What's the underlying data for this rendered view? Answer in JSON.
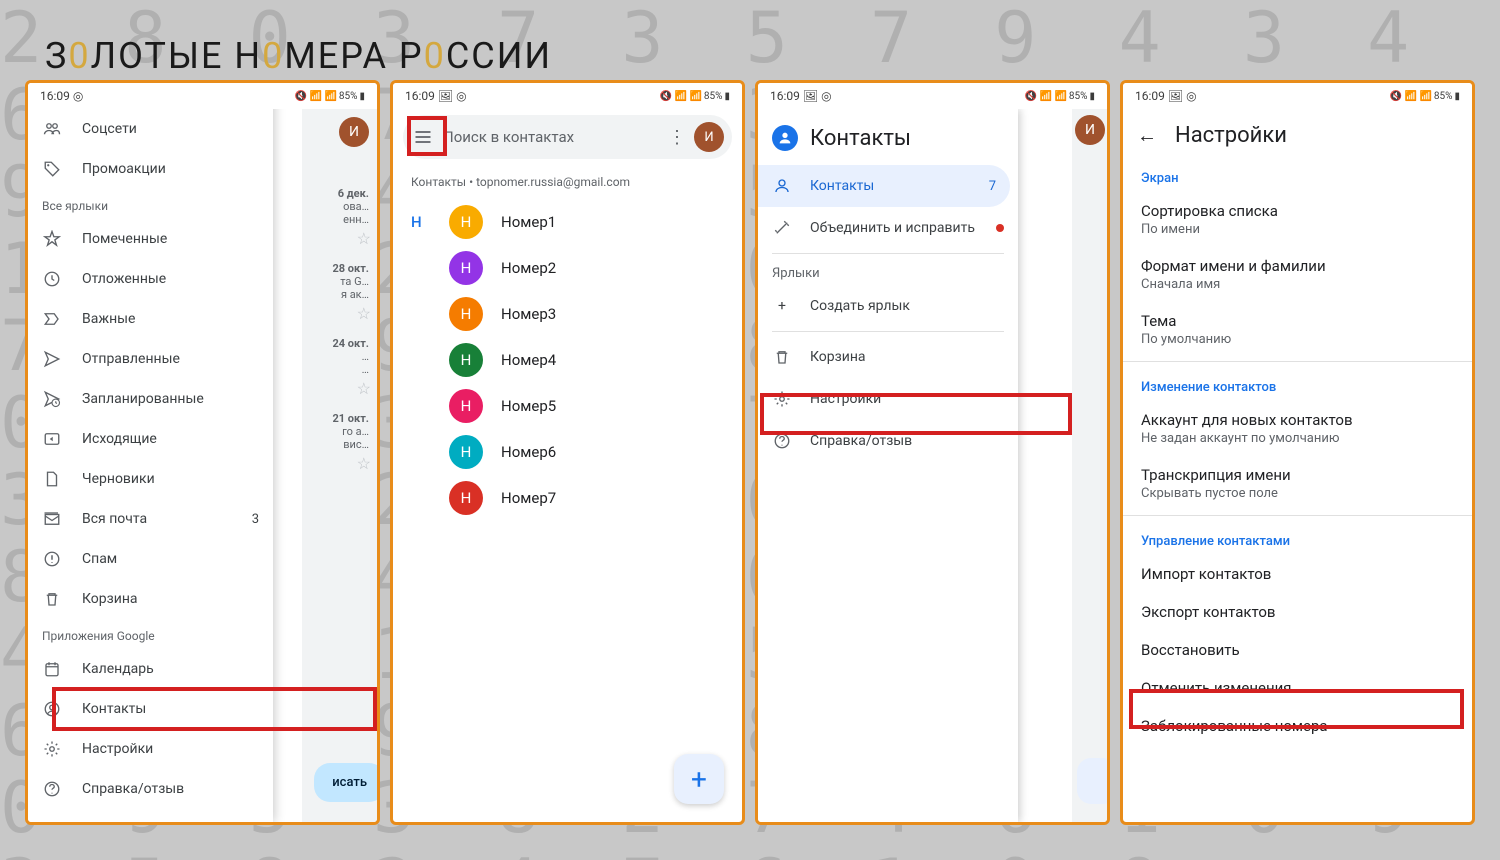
{
  "background_numbers": "2 8 0 3 7 3 5 7 9 4 3 4 6 1 8 7 2 5 3 0 4 2 7 0 9 3 6 4 0 1 5 8 3 9 4 6 1 8 7 2 9 5 0 3 8 4 6 2 7 1 0 9 3 5 8 2 4 7 6 1 0 9 5 3 8 2 7 4 6 1 0 9 3 5 8 2 4 7 6 1 0 9 5 3 8 2 7 4 6 1 0 9 3 5 8 2 4 7 6 1 0 9 5 3 8 2 7 4 6 1 0 9 3 5 8 2 4 7 6 1 0 9 5 3 8 2 7 4 6 1 0 9 3 5 8 2 4 7 6 1 0 9",
  "logo": {
    "t1": "З",
    "g1": "0",
    "t2": "ЛОТЫЕ Н",
    "g2": "0",
    "t3": "МЕРА Р",
    "g3": "0",
    "t4": "ССИИ"
  },
  "statusbar": {
    "time": "16:09",
    "battery": "85%"
  },
  "screen1": {
    "drawer": {
      "items_top": [
        {
          "icon": "group",
          "label": "Соцсети"
        },
        {
          "icon": "tag",
          "label": "Промоакции"
        }
      ],
      "section_labels": "Все ярлыки",
      "items_labels": [
        {
          "icon": "star",
          "label": "Помеченные"
        },
        {
          "icon": "clock",
          "label": "Отложенные"
        },
        {
          "icon": "important",
          "label": "Важные"
        },
        {
          "icon": "send",
          "label": "Отправленные"
        },
        {
          "icon": "schedule-send",
          "label": "Запланированные"
        },
        {
          "icon": "outbox",
          "label": "Исходящие"
        },
        {
          "icon": "file",
          "label": "Черновики"
        },
        {
          "icon": "all-mail",
          "label": "Вся почта",
          "badge": "3"
        },
        {
          "icon": "spam",
          "label": "Спам"
        },
        {
          "icon": "trash",
          "label": "Корзина"
        }
      ],
      "section_apps": "Приложения Google",
      "items_apps": [
        {
          "icon": "calendar",
          "label": "Календарь"
        },
        {
          "icon": "contacts",
          "label": "Контакты"
        },
        {
          "icon": "gear",
          "label": "Настройки"
        },
        {
          "icon": "help",
          "label": "Справка/отзыв"
        }
      ]
    },
    "inbox": {
      "avatar_letter": "И",
      "rows": [
        {
          "date": "6 дек.",
          "l1": "ова…",
          "l2": "енн…"
        },
        {
          "date": "28 окт.",
          "l1": "та G…",
          "l2": "я ак…"
        },
        {
          "date": "24 окт.",
          "l1": "…",
          "l2": "…"
        },
        {
          "date": "21 окт.",
          "l1": "го а…",
          "l2": "вис…"
        }
      ],
      "compose": "исать"
    }
  },
  "screen2": {
    "search_placeholder": "Поиск в контактах",
    "account_line": "Контакты • topnomer.russia@gmail.com",
    "avatar_letter": "И",
    "index_letter": "Н",
    "contacts": [
      {
        "letter": "Н",
        "name": "Номер1",
        "color": "#f9ab00"
      },
      {
        "letter": "Н",
        "name": "Номер2",
        "color": "#9334e6"
      },
      {
        "letter": "Н",
        "name": "Номер3",
        "color": "#f57c00"
      },
      {
        "letter": "Н",
        "name": "Номер4",
        "color": "#188038"
      },
      {
        "letter": "Н",
        "name": "Номер5",
        "color": "#e91e63"
      },
      {
        "letter": "Н",
        "name": "Номер6",
        "color": "#00acc1"
      },
      {
        "letter": "Н",
        "name": "Номер7",
        "color": "#d93025"
      }
    ]
  },
  "screen3": {
    "title": "Контакты",
    "items": [
      {
        "icon": "person",
        "label": "Контакты",
        "badge": "7",
        "active": true
      },
      {
        "icon": "wand",
        "label": "Объединить и исправить",
        "dot": true
      }
    ],
    "section_labels": "Ярлыки",
    "create_label": "Создать ярлык",
    "items_bottom": [
      {
        "icon": "trash",
        "label": "Корзина"
      },
      {
        "icon": "gear",
        "label": "Настройки"
      },
      {
        "icon": "help",
        "label": "Справка/отзыв"
      }
    ],
    "side_avatar": "И"
  },
  "screen4": {
    "title": "Настройки",
    "sections": [
      {
        "header": "Экран",
        "items": [
          {
            "title": "Сортировка списка",
            "sub": "По имени"
          },
          {
            "title": "Формат имени и фамилии",
            "sub": "Сначала имя"
          },
          {
            "title": "Тема",
            "sub": "По умолчанию"
          }
        ]
      },
      {
        "header": "Изменение контактов",
        "items": [
          {
            "title": "Аккаунт для новых контактов",
            "sub": "Не задан аккаунт по умолчанию"
          },
          {
            "title": "Транскрипция имени",
            "sub": "Скрывать пустое поле"
          }
        ]
      },
      {
        "header": "Управление контактами",
        "items": [
          {
            "title": "Импорт контактов"
          },
          {
            "title": "Экспорт контактов"
          },
          {
            "title": "Восстановить"
          },
          {
            "title": "Отменить изменения"
          },
          {
            "title": "Заблокированные номера"
          }
        ]
      }
    ]
  },
  "icons": {
    "group": "👥",
    "tag": "🏷",
    "star": "☆",
    "clock": "🕒",
    "important": "❯",
    "send": "➤",
    "schedule-send": "⏱",
    "outbox": "▶",
    "file": "📄",
    "all-mail": "✉",
    "spam": "⚠",
    "trash": "🗑",
    "calendar": "📅",
    "contacts": "👤",
    "gear": "⚙",
    "help": "?",
    "person": "👤",
    "wand": "✨",
    "plus": "+"
  }
}
